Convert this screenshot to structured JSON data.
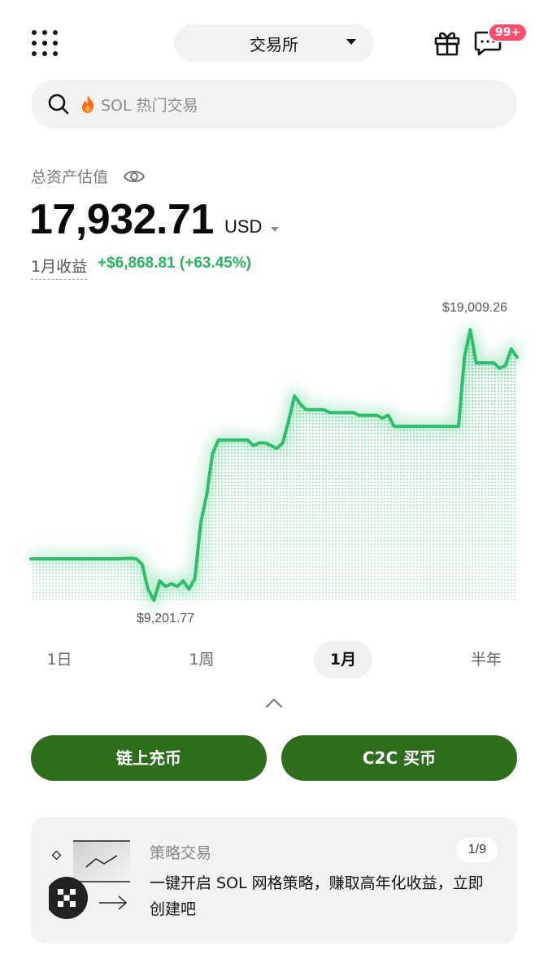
{
  "header": {
    "apps_icon": "grid-icon",
    "exchange_label": "交易所",
    "gift_icon": "gift-icon",
    "message_icon": "chat-icon",
    "badge": "99+"
  },
  "search": {
    "placeholder": "SOL 热门交易",
    "icon": "search-icon",
    "fire_icon": "fire-icon"
  },
  "asset": {
    "label": "总资产估值",
    "balance": "17,932.71",
    "currency": "USD",
    "pnl_label": "1月收益",
    "pnl_value": "+$6,868.81 (+63.45%)"
  },
  "chart_data": {
    "type": "line",
    "title": "",
    "max_label": "$19,009.26",
    "min_label": "$9,201.77",
    "ylim": [
      9201.77,
      19009.26
    ],
    "color": "#2dbe6b",
    "y": [
      10700,
      10700,
      10700,
      10700,
      10700,
      10700,
      10700,
      10700,
      10700,
      10700,
      10700,
      10700,
      10700,
      10700,
      10700,
      10700,
      10720,
      10720,
      10700,
      10500,
      9600,
      9200,
      9900,
      9700,
      9800,
      9700,
      9900,
      9600,
      10000,
      12000,
      13000,
      14500,
      15000,
      15000,
      15000,
      15000,
      15000,
      15000,
      14800,
      14900,
      14900,
      14800,
      14700,
      14900,
      15700,
      16600,
      16300,
      16100,
      16100,
      16100,
      16100,
      16000,
      16000,
      16000,
      16000,
      16000,
      15900,
      15900,
      15900,
      15900,
      15800,
      15900,
      15500,
      15500,
      15500,
      15500,
      15500,
      15500,
      15500,
      15500,
      15500,
      15500,
      15500,
      15500,
      18000,
      19000,
      17800,
      17800,
      17800,
      17800,
      17600,
      17700,
      18300,
      18000
    ]
  },
  "range_tabs": [
    "1日",
    "1周",
    "1月",
    "半年"
  ],
  "active_tab": "1月",
  "actions": {
    "deposit": "链上充币",
    "c2c": "C2C 买币"
  },
  "strategy_card": {
    "title": "策略交易",
    "description": "一键开启 SOL 网格策略，赚取高年化收益，立即创建吧",
    "pager": "1/9"
  }
}
